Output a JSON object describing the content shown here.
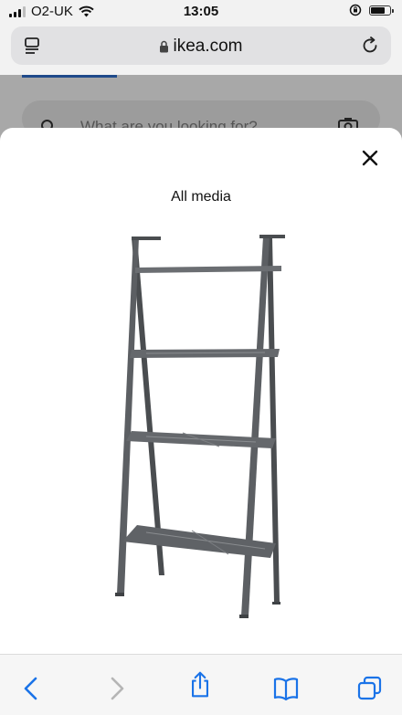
{
  "status_bar": {
    "carrier": "O2-UK",
    "time": "13:05"
  },
  "browser": {
    "domain": "ikea.com"
  },
  "page_behind": {
    "search_placeholder": "What are you looking for?"
  },
  "modal": {
    "title": "All media",
    "product_image_desc": "Grey metal ladder shelving unit with four shelves"
  },
  "colors": {
    "accent": "#1f4a8a",
    "toolbar_icon": "#1a73e8",
    "shelf": "#55585c"
  },
  "icons": {
    "wifi": "wifi-icon",
    "orientation_lock": "orientation-lock-icon",
    "battery": "battery-icon",
    "tabs": "tabs-overview-icon",
    "lock": "lock-icon",
    "reload": "reload-icon",
    "search": "search-icon",
    "camera": "camera-icon",
    "close": "close-icon",
    "back": "back-arrow-icon",
    "forward": "forward-arrow-icon",
    "share": "share-icon",
    "bookmarks": "bookmarks-icon",
    "tabs_bottom": "tabs-icon"
  }
}
